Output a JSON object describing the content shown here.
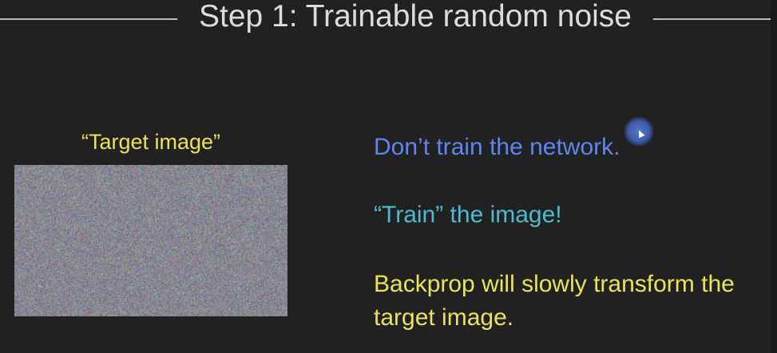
{
  "slide": {
    "title": "Step 1: Trainable random noise",
    "image_caption": "“Target image”",
    "points": [
      {
        "text": "Don’t train the network.",
        "color": "#5e86f2"
      },
      {
        "text": "“Train” the image!",
        "color": "#4cbad0"
      },
      {
        "text": "Backprop will slowly transform the target image.",
        "color": "#ece25a"
      }
    ]
  }
}
